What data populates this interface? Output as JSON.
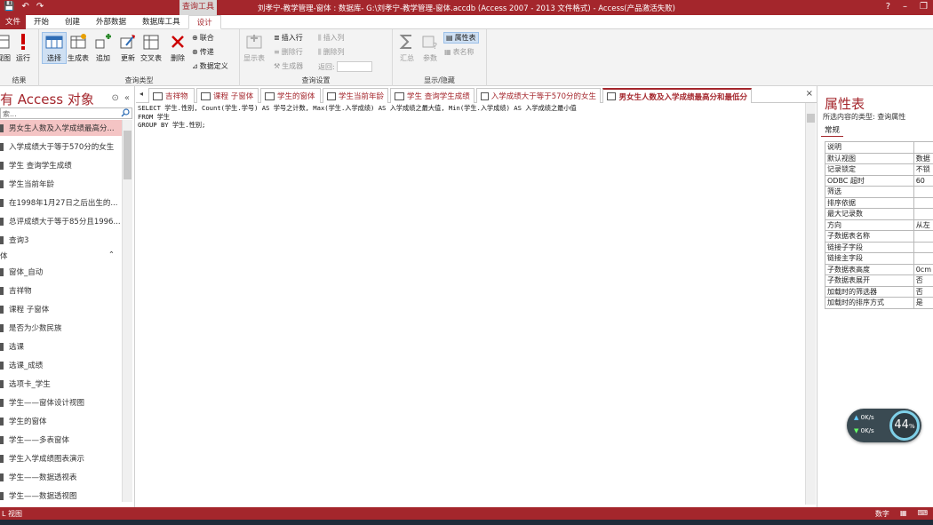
{
  "titlebar": {
    "context_tab": "查询工具",
    "title": "刘孝宁-教学管理-窗体 : 数据库- G:\\刘孝宁-教学管理-窗体.accdb (Access 2007 - 2013 文件格式) - Access(产品激活失败)",
    "help": "?",
    "minimize": "–",
    "restore": "❐"
  },
  "ribbon_tabs": [
    {
      "label": "文件"
    },
    {
      "label": "开始"
    },
    {
      "label": "创建"
    },
    {
      "label": "外部数据"
    },
    {
      "label": "数据库工具"
    },
    {
      "label": "设计"
    }
  ],
  "ribbon": {
    "results": {
      "view": "视图",
      "run": "运行",
      "label": "结果"
    },
    "query_type": {
      "select": "选择",
      "make_table": "生成表",
      "append": "追加",
      "update": "更新",
      "crosstab": "交叉表",
      "delete": "删除",
      "union": "联合",
      "passthrough": "传递",
      "data_def": "数据定义",
      "label": "查询类型"
    },
    "query_setup": {
      "show_table": "显示表",
      "insert_rows": "插入行",
      "delete_rows": "删除行",
      "builder": "生成器",
      "insert_cols": "插入列",
      "delete_cols": "删除列",
      "return": "返回:",
      "label": "查询设置"
    },
    "show_hide": {
      "totals": "汇总",
      "parameters": "参数",
      "property_sheet": "属性表",
      "table_names": "表名称",
      "label": "显示/隐藏"
    }
  },
  "nav": {
    "title": "有 Access 对象",
    "search_placeholder": "索...",
    "queries": [
      {
        "label": "男女生人数及入学成绩最高分..."
      },
      {
        "label": "入学成绩大于等于570分的女生"
      },
      {
        "label": "学生 查询学生成绩"
      },
      {
        "label": "学生当前年龄"
      },
      {
        "label": "在1998年1月27日之后出生的..."
      },
      {
        "label": "总评成绩大于等于85分且1996..."
      },
      {
        "label": "查询3"
      }
    ],
    "forms_section": "体",
    "forms": [
      {
        "label": "窗体_自动"
      },
      {
        "label": "吉祥物"
      },
      {
        "label": "课程 子窗体"
      },
      {
        "label": "是否为少数民族"
      },
      {
        "label": "选课"
      },
      {
        "label": "选课_成绩"
      },
      {
        "label": "选项卡_学生"
      },
      {
        "label": "学生——窗体设计视图"
      },
      {
        "label": "学生的窗体"
      },
      {
        "label": "学生——多表窗体"
      },
      {
        "label": "学生入学成绩图表演示"
      },
      {
        "label": "学生——数据透视表"
      },
      {
        "label": "学生——数据透视图"
      }
    ]
  },
  "doc_tabs": [
    {
      "label": "吉祥物"
    },
    {
      "label": "课程 子窗体"
    },
    {
      "label": "学生的窗体"
    },
    {
      "label": "学生当前年龄"
    },
    {
      "label": "学生 查询学生成绩"
    },
    {
      "label": "入学成绩大于等于570分的女生"
    },
    {
      "label": "男女生人数及入学成绩最高分和最低分"
    }
  ],
  "sql": {
    "line1": "SELECT 学生.性别, Count(学生.学号) AS 学号之计数, Max(学生.入学成绩) AS 入学成绩之最大值, Min(学生.入学成绩) AS 入学成绩之最小值",
    "line2": "FROM 学生",
    "line3": "GROUP BY 学生.性别;"
  },
  "property_sheet": {
    "title": "属性表",
    "selection_type": "所选内容的类型: 查询属性",
    "tab": "常规",
    "rows": [
      {
        "key": "说明",
        "value": ""
      },
      {
        "key": "默认视图",
        "value": "数据"
      },
      {
        "key": "记录锁定",
        "value": "不锁"
      },
      {
        "key": "ODBC 超时",
        "value": "60"
      },
      {
        "key": "筛选",
        "value": ""
      },
      {
        "key": "排序依据",
        "value": ""
      },
      {
        "key": "最大记录数",
        "value": ""
      },
      {
        "key": "方向",
        "value": "从左"
      },
      {
        "key": "子数据表名称",
        "value": ""
      },
      {
        "key": "链接子字段",
        "value": ""
      },
      {
        "key": "链接主字段",
        "value": ""
      },
      {
        "key": "子数据表高度",
        "value": "0cm"
      },
      {
        "key": "子数据表展开",
        "value": "否"
      },
      {
        "key": "加载时的筛选器",
        "value": "否"
      },
      {
        "key": "加载时的排序方式",
        "value": "是"
      }
    ]
  },
  "net_widget": {
    "up": "0K/s",
    "down": "0K/s",
    "gauge": "44",
    "gauge_unit": "%"
  },
  "statusbar": {
    "left": "L 视图",
    "num": "数字"
  }
}
